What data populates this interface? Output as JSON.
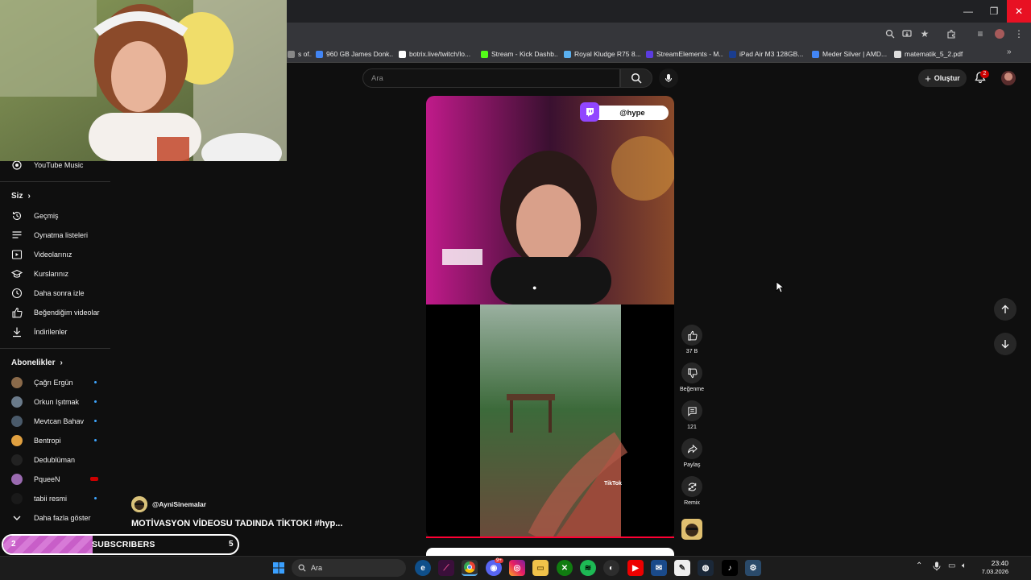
{
  "browser": {
    "bookmarks": [
      {
        "label": "s of...",
        "icon": "generic",
        "color": "#888888"
      },
      {
        "label": "960 GB James Donk...",
        "icon": "ih-icon",
        "color": "#4285f4"
      },
      {
        "label": "botrix.live/twitch/lo...",
        "icon": "diamond-icon",
        "color": "#ffffff"
      },
      {
        "label": "Stream - Kick Dashb...",
        "icon": "kick-icon",
        "color": "#53fc18"
      },
      {
        "label": "Royal Kludge R75 8...",
        "icon": "gem-icon",
        "color": "#5ab0f0"
      },
      {
        "label": "StreamElements - M...",
        "icon": "streamelements-icon",
        "color": "#5b3ce0"
      },
      {
        "label": "iPad Air M3 128GB...",
        "icon": "v-icon",
        "color": "#1a3d8f"
      },
      {
        "label": "Meder Silver | AMD...",
        "icon": "ih-icon",
        "color": "#4285f4"
      },
      {
        "label": "matematik_5_2.pdf",
        "icon": "doc-icon",
        "color": "#dddddd"
      }
    ]
  },
  "header": {
    "search_placeholder": "Ara",
    "create_label": "Oluştur",
    "notification_count": "2"
  },
  "sidebar": {
    "music_item": "YouTube Music",
    "you_heading": "Siz",
    "you_items": [
      {
        "label": "Geçmiş",
        "icon": "history-icon"
      },
      {
        "label": "Oynatma listeleri",
        "icon": "playlists-icon"
      },
      {
        "label": "Videolarınız",
        "icon": "your-videos-icon"
      },
      {
        "label": "Kurslarınız",
        "icon": "courses-icon"
      },
      {
        "label": "Daha sonra izle",
        "icon": "watch-later-icon"
      },
      {
        "label": "Beğendiğim videolar",
        "icon": "liked-icon"
      },
      {
        "label": "İndirilenler",
        "icon": "downloads-icon"
      }
    ],
    "subs_heading": "Abonelikler",
    "subscriptions": [
      {
        "label": "Çağrı Ergün",
        "color": "#8a6a4a",
        "indicator": "dot"
      },
      {
        "label": "Orkun Işıtmak",
        "color": "#6a7a8a",
        "indicator": "dot"
      },
      {
        "label": "Mevtcan Bahav",
        "color": "#4a5a6a",
        "indicator": "dot"
      },
      {
        "label": "Bentropi",
        "color": "#e0a040",
        "indicator": "dot"
      },
      {
        "label": "Dedublüman",
        "color": "#222222",
        "indicator": "none"
      },
      {
        "label": "PqueeN",
        "color": "#9a6ab0",
        "indicator": "live"
      },
      {
        "label": "tabii resmi",
        "color": "#1a1a1a",
        "indicator": "dot"
      }
    ],
    "show_more": "Daha fazla göster"
  },
  "short": {
    "twitch_handle": "@hype",
    "channel_name": "@AyniSinemalar",
    "title": "MOTİVASYON VİDEOSU TADINDA TİKTOK! #hyp...",
    "progress": 0.999,
    "watermark": "TikTok"
  },
  "actions": {
    "like_count": "37 B",
    "dislike_label": "Beğenme",
    "comment_count": "121",
    "share_label": "Paylaş",
    "remix_label": "Remix"
  },
  "subs_goal": {
    "start": "2",
    "label": "SUBSCRIBERS",
    "goal": "5",
    "fill_fraction": 0.38
  },
  "taskbar": {
    "search_label": "Ara",
    "time": "23:40",
    "date": "7.03.2026",
    "discord_badge": "9+"
  }
}
